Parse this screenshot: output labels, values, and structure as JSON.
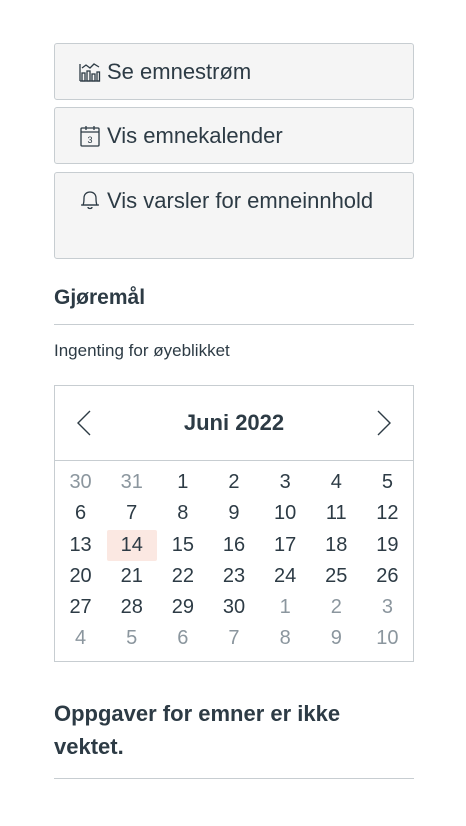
{
  "sidebar": {
    "buttons": [
      {
        "label": "Se emnestrøm",
        "icon": "stream-icon"
      },
      {
        "label": "Vis emnekalender",
        "icon": "calendar-icon"
      },
      {
        "label": "Vis varsler for emneinnhold",
        "icon": "bell-icon"
      }
    ],
    "todo": {
      "title": "Gjøremål",
      "empty_text": "Ingenting for øyeblikket"
    },
    "calendar": {
      "month_label": "Juni 2022",
      "prev_label": "forrige måned",
      "next_label": "neste måned",
      "today": "14",
      "weeks": [
        [
          {
            "d": "30",
            "o": true
          },
          {
            "d": "31",
            "o": true
          },
          {
            "d": "1"
          },
          {
            "d": "2"
          },
          {
            "d": "3"
          },
          {
            "d": "4"
          },
          {
            "d": "5"
          }
        ],
        [
          {
            "d": "6"
          },
          {
            "d": "7"
          },
          {
            "d": "8"
          },
          {
            "d": "9"
          },
          {
            "d": "10"
          },
          {
            "d": "11"
          },
          {
            "d": "12"
          }
        ],
        [
          {
            "d": "13"
          },
          {
            "d": "14",
            "t": true
          },
          {
            "d": "15"
          },
          {
            "d": "16"
          },
          {
            "d": "17"
          },
          {
            "d": "18"
          },
          {
            "d": "19"
          }
        ],
        [
          {
            "d": "20"
          },
          {
            "d": "21"
          },
          {
            "d": "22"
          },
          {
            "d": "23"
          },
          {
            "d": "24"
          },
          {
            "d": "25"
          },
          {
            "d": "26"
          }
        ],
        [
          {
            "d": "27"
          },
          {
            "d": "28"
          },
          {
            "d": "29"
          },
          {
            "d": "30"
          },
          {
            "d": "1",
            "o": true
          },
          {
            "d": "2",
            "o": true
          },
          {
            "d": "3",
            "o": true
          }
        ],
        [
          {
            "d": "4",
            "o": true
          },
          {
            "d": "5",
            "o": true
          },
          {
            "d": "6",
            "o": true
          },
          {
            "d": "7",
            "o": true
          },
          {
            "d": "8",
            "o": true
          },
          {
            "d": "9",
            "o": true
          },
          {
            "d": "10",
            "o": true
          }
        ]
      ]
    },
    "grading_note": "Oppgaver for emner er ikke vektet."
  },
  "colors": {
    "text": "#2d3b45",
    "muted": "#8b969e",
    "border": "#c7cdd1",
    "button_bg": "#f5f5f5",
    "today_bg": "#fbe8e2"
  }
}
